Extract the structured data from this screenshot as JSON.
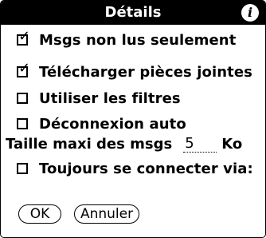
{
  "dialog": {
    "title": "Détails",
    "info_icon": "i"
  },
  "options": [
    {
      "label": "Msgs non lus seulement",
      "checked": true
    },
    {
      "label": "Télécharger pièces jointes",
      "checked": true
    },
    {
      "label": "Utiliser les filtres",
      "checked": false
    },
    {
      "label": "Déconnexion auto",
      "checked": false
    }
  ],
  "size": {
    "label": "Taille maxi des msgs",
    "value": "5",
    "unit": "Ko"
  },
  "connect_option": {
    "label": "Toujours se connecter via:",
    "checked": false
  },
  "buttons": {
    "ok": "OK",
    "cancel": "Annuler"
  }
}
